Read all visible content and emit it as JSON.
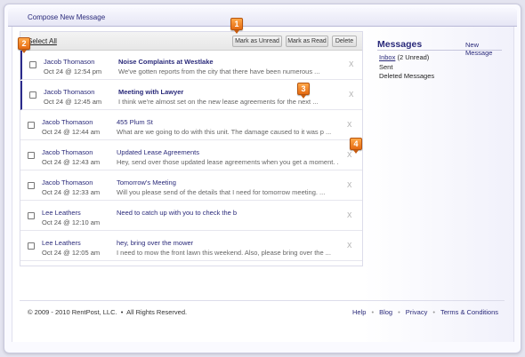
{
  "topbar": {
    "compose_label": "Compose New Message"
  },
  "toolbar": {
    "select_all": "Select All",
    "mark_unread": "Mark as Unread",
    "mark_read": "Mark as Read",
    "delete": "Delete"
  },
  "messages": [
    {
      "sender": "Jacob Thomason",
      "date": "Oct 24 @ 12:54 pm",
      "subject": "Noise Complaints at Westlake",
      "preview": "We've gotten reports from the city that there have been numerous ...",
      "unread": true,
      "delete_icon": "X"
    },
    {
      "sender": "Jacob Thomason",
      "date": "Oct 24 @ 12:45 am",
      "subject": "Meeting with Lawyer",
      "preview": "I think we're almost set on the new lease agreements for the next ...",
      "unread": true,
      "delete_icon": "X"
    },
    {
      "sender": "Jacob Thomason",
      "date": "Oct 24 @ 12:44 am",
      "subject": "455 Plum St",
      "preview": "What are we going to do with this unit. The damage caused to it was p ...",
      "unread": false,
      "delete_icon": "X"
    },
    {
      "sender": "Jacob Thomason",
      "date": "Oct 24 @ 12:43 am",
      "subject": "Updated Lease Agreements",
      "preview": "Hey, send over those updated lease agreements when you get a moment. ...",
      "unread": false,
      "delete_icon": "X"
    },
    {
      "sender": "Jacob Thomason",
      "date": "Oct 24 @ 12:33 am",
      "subject": "Tomorrow's Meeting",
      "preview": "Will you please send of the details that I need for tomorrow meeting. ...",
      "unread": false,
      "delete_icon": "X"
    },
    {
      "sender": "Lee Leathers",
      "date": "Oct 24 @ 12:10 am",
      "subject": "Need to catch up with you to check the b",
      "preview": "",
      "unread": false,
      "delete_icon": "X"
    },
    {
      "sender": "Lee Leathers",
      "date": "Oct 24 @ 12:05 am",
      "subject": "hey, bring over the mower",
      "preview": "I need to mow the front lawn this weekend. Also, please bring over the ...",
      "unread": false,
      "delete_icon": "X"
    }
  ],
  "sidebar": {
    "title": "Messages",
    "new_message": "New Message",
    "inbox": "Inbox",
    "inbox_count": "(2 Unread)",
    "sent": "Sent",
    "deleted": "Deleted Messages"
  },
  "footer": {
    "copyright": "© 2009 - 2010 RentPost, LLC.",
    "rights": "All Rights Reserved.",
    "links": [
      "Help",
      "Blog",
      "Privacy",
      "Terms & Conditions"
    ]
  },
  "callouts": [
    "1",
    "2",
    "3",
    "4"
  ],
  "colors": {
    "accent": "#2a2a7a",
    "callout": "#e46a12",
    "unread_bar": "#2b2b8c"
  }
}
